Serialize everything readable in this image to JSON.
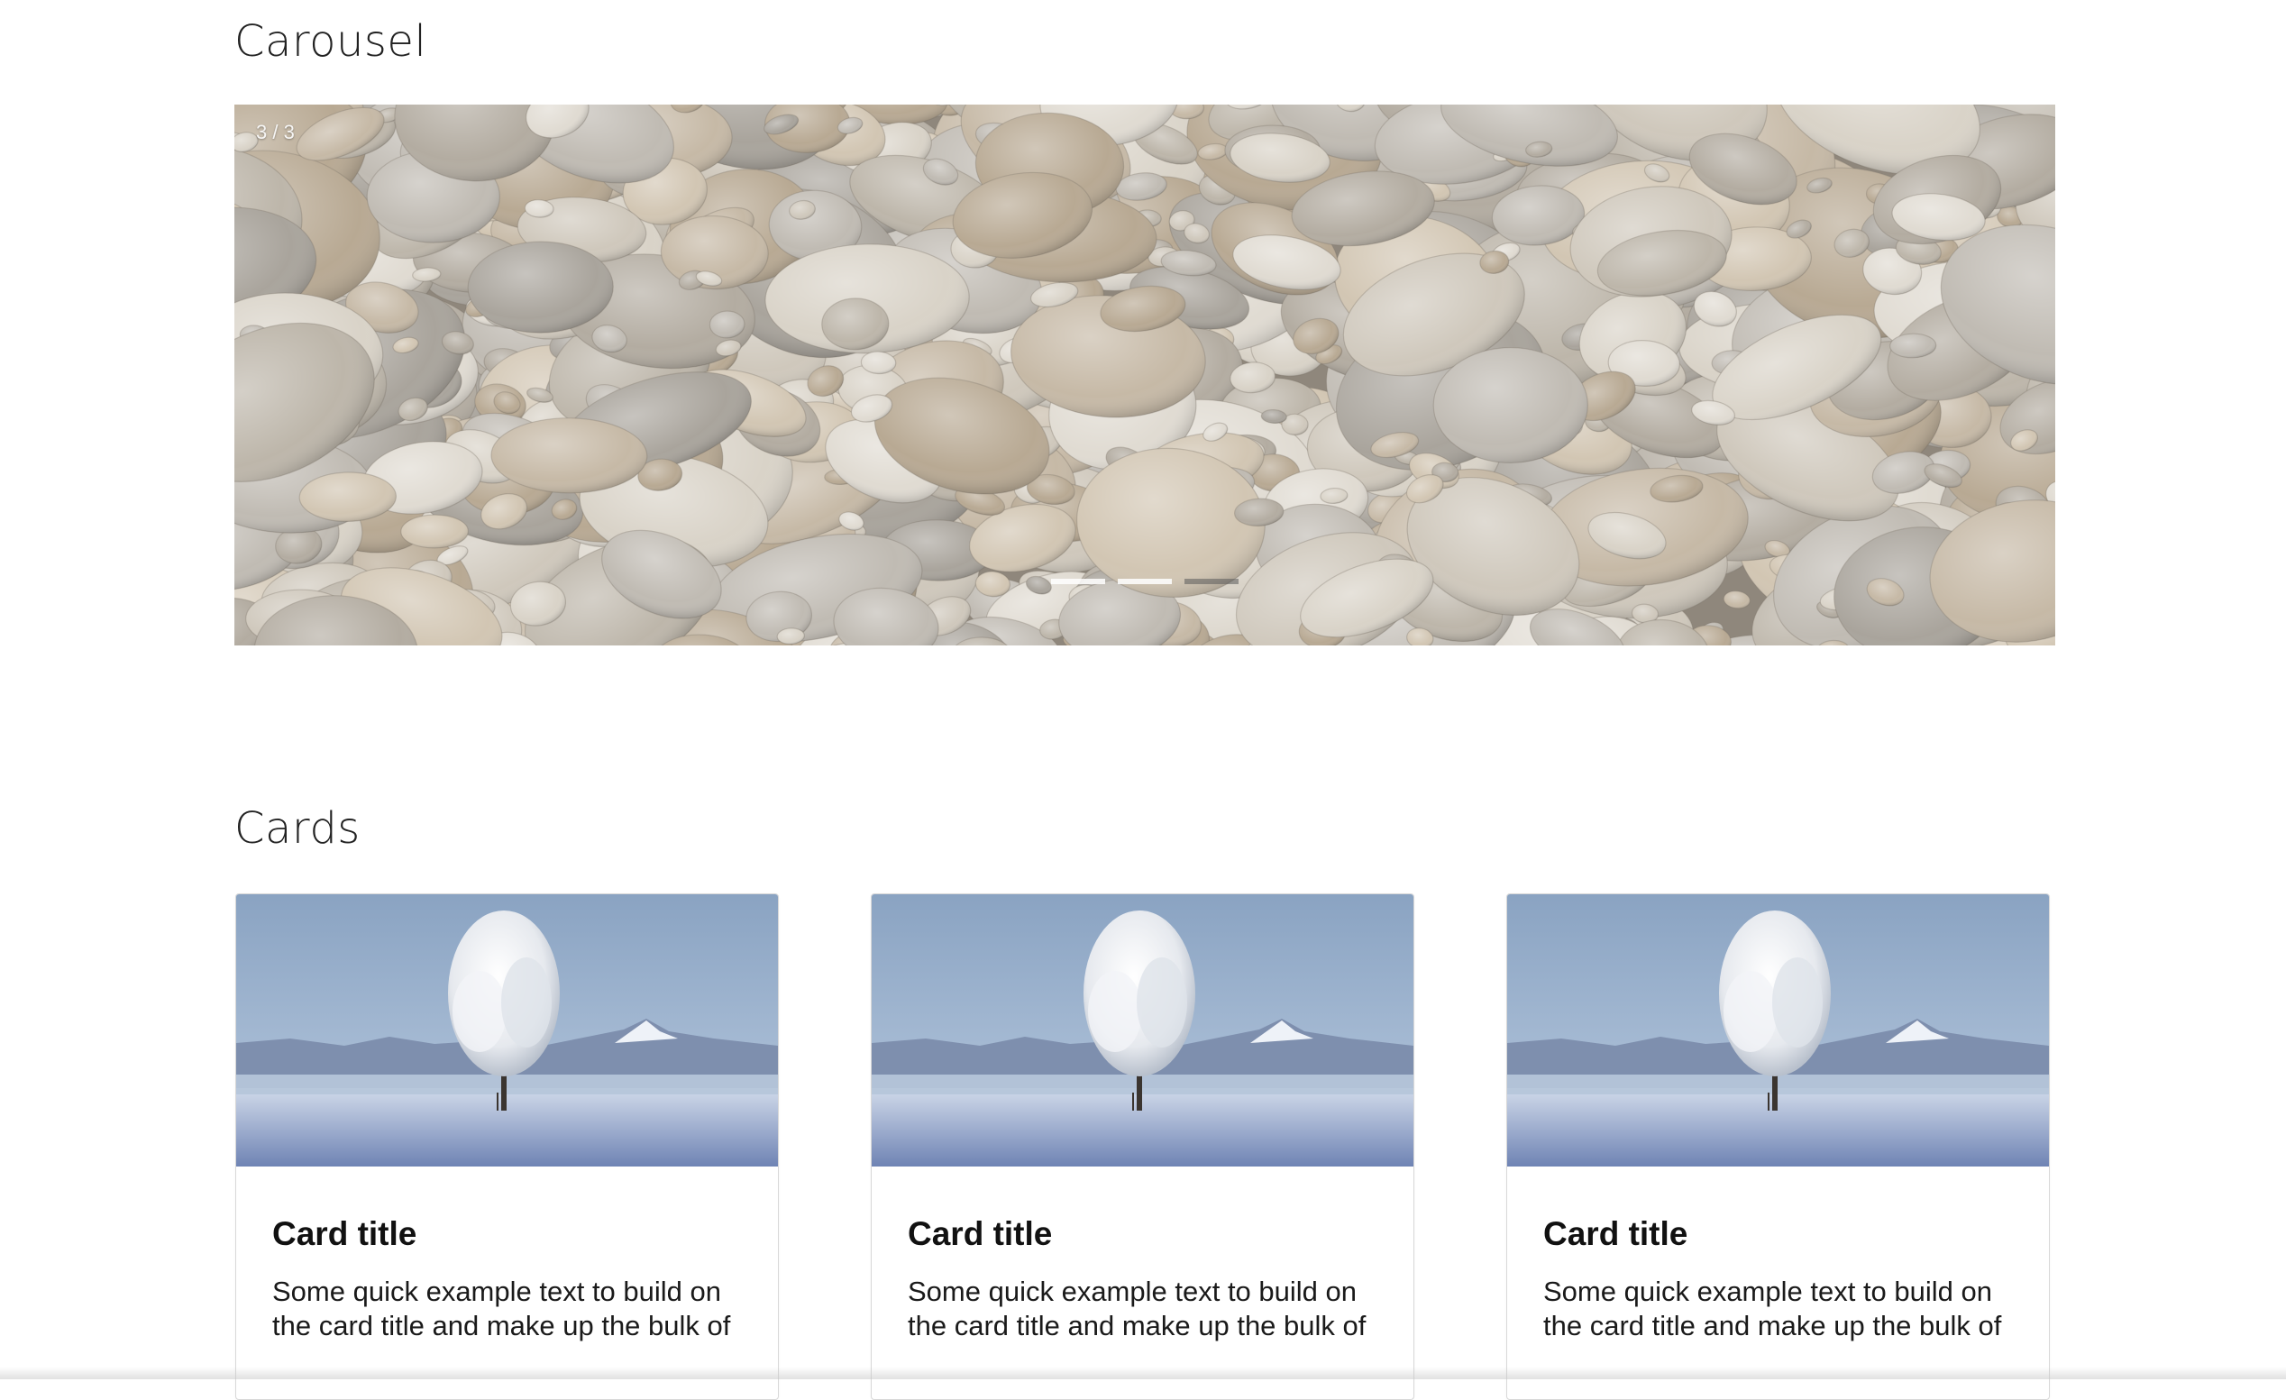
{
  "carousel": {
    "heading": "Carousel",
    "counter": "3 / 3",
    "slide_count": 3,
    "active_slide": 3,
    "image_subject": "beach-pebbles"
  },
  "cards_section": {
    "heading": "Cards",
    "cards": [
      {
        "title": "Card title",
        "text": "Some quick example text to build on the card title and make up the bulk of",
        "image_subject": "snow-covered-tree"
      },
      {
        "title": "Card title",
        "text": "Some quick example text to build on the card title and make up the bulk of",
        "image_subject": "snow-covered-tree"
      },
      {
        "title": "Card title",
        "text": "Some quick example text to build on the card title and make up the bulk of",
        "image_subject": "snow-covered-tree"
      }
    ]
  }
}
